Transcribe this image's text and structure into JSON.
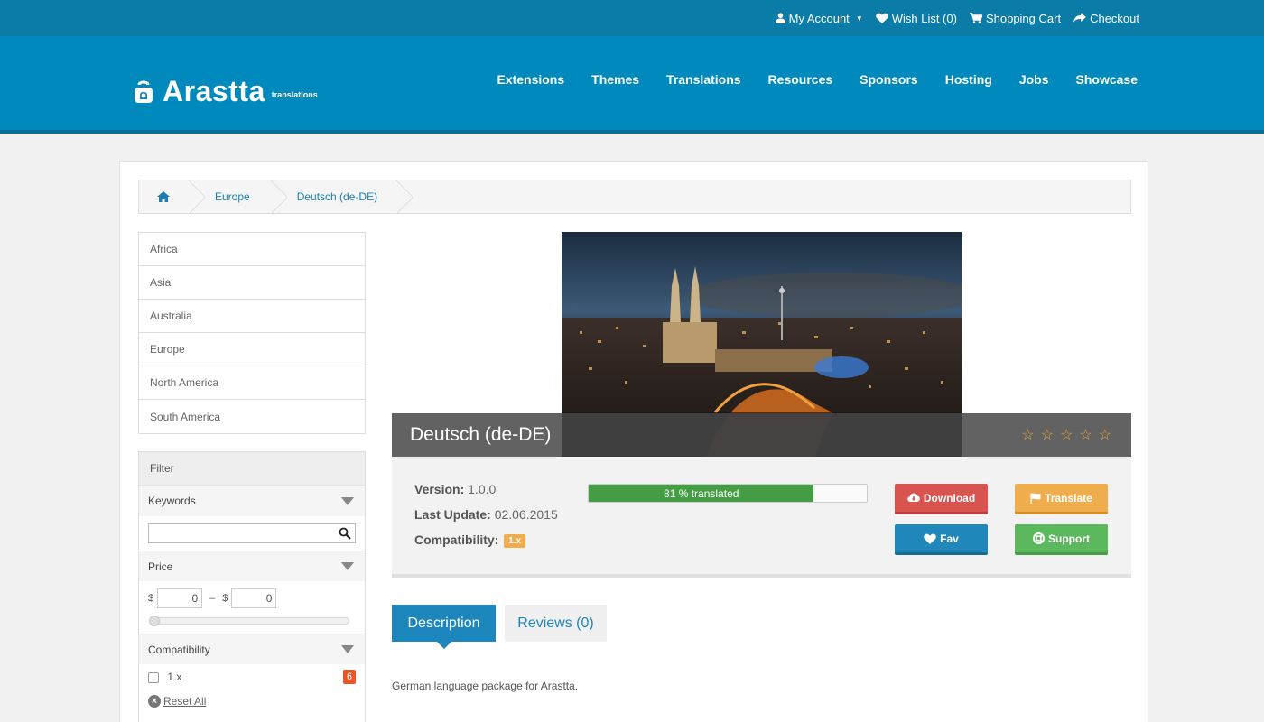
{
  "topbar": {
    "my_account": "My Account",
    "wish_list": "Wish List (0)",
    "shopping_cart": "Shopping Cart",
    "checkout": "Checkout"
  },
  "logo": {
    "name": "Arastta",
    "sub": "translations"
  },
  "nav": [
    "Extensions",
    "Themes",
    "Translations",
    "Resources",
    "Sponsors",
    "Hosting",
    "Jobs",
    "Showcase"
  ],
  "breadcrumb": {
    "home_icon": "home-icon",
    "items": [
      "Europe",
      "Deutsch (de-DE)"
    ]
  },
  "categories": [
    "Africa",
    "Asia",
    "Australia",
    "Europe",
    "North America",
    "South America"
  ],
  "filter": {
    "title": "Filter",
    "keywords_label": "Keywords",
    "keywords_value": "",
    "price_label": "Price",
    "currency": "$",
    "price_min": "0",
    "price_max": "0",
    "price_dash": "–",
    "compat_label": "Compatibility",
    "compat_option": "1.x",
    "compat_count": "6",
    "reset_label": "Reset All"
  },
  "product": {
    "title": "Deutsch (de-DE)",
    "rating": 0,
    "rating_max": 5,
    "version_label": "Version:",
    "version": "1.0.0",
    "updated_label": "Last Update:",
    "updated": "02.06.2015",
    "compat_label": "Compatibility:",
    "compat": "1.x",
    "progress_percent": 81,
    "progress_text": "81 %  translated",
    "download": "Download",
    "translate": "Translate",
    "fav": "Fav",
    "support": "Support"
  },
  "tabs": {
    "description": "Description",
    "reviews": "Reviews (0)"
  },
  "description": "German language package for Arastta.",
  "colors": {
    "topbar": "#0b7ba8",
    "header": "#0089bd",
    "accent": "#1c86bd",
    "danger": "#d9534f",
    "warning": "#f0ad4e",
    "success": "#5cb85c"
  }
}
